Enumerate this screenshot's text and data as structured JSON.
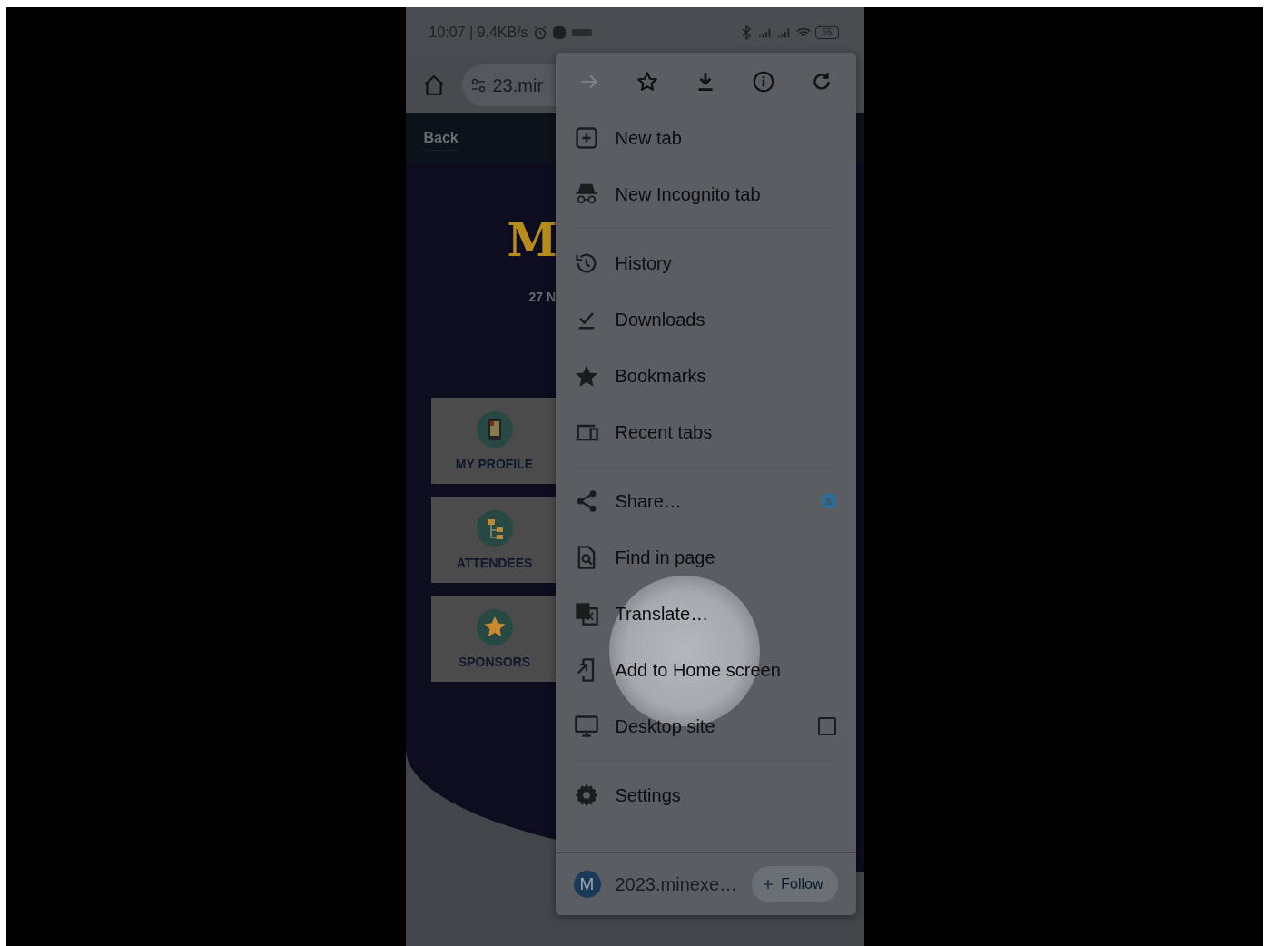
{
  "status_bar": {
    "text": "10:07 | 9.4KB/s",
    "battery": "55"
  },
  "toolbar": {
    "url": "23.mir"
  },
  "page": {
    "back_button": "Back",
    "logo_text": "M",
    "date": "27 N",
    "tiles": [
      {
        "label": "MY PROFILE",
        "kind": "profile"
      },
      {
        "label": "ATTENDEES",
        "kind": "attendees"
      },
      {
        "label": "SPONSORS",
        "kind": "sponsors"
      }
    ]
  },
  "menu": {
    "top_icons": [
      {
        "kind": "forward",
        "disabled": true
      },
      {
        "kind": "star",
        "disabled": false
      },
      {
        "kind": "download",
        "disabled": false
      },
      {
        "kind": "info",
        "disabled": false
      },
      {
        "kind": "refresh",
        "disabled": false
      }
    ],
    "groups": [
      [
        {
          "label": "New tab",
          "kind": "newtab"
        },
        {
          "label": "New Incognito tab",
          "kind": "incognito"
        }
      ],
      [
        {
          "label": "History",
          "kind": "history"
        },
        {
          "label": "Downloads",
          "kind": "downloads"
        },
        {
          "label": "Bookmarks",
          "kind": "bookmarks"
        },
        {
          "label": "Recent tabs",
          "kind": "recent"
        }
      ],
      [
        {
          "label": "Share…",
          "kind": "share",
          "badge": "S"
        },
        {
          "label": "Find in page",
          "kind": "find"
        },
        {
          "label": "Translate…",
          "kind": "translate"
        },
        {
          "label": "Add to Home screen",
          "kind": "addhome"
        },
        {
          "label": "Desktop site",
          "kind": "desktop",
          "checked": false
        }
      ],
      [
        {
          "label": "Settings",
          "kind": "settings"
        }
      ]
    ],
    "footer": {
      "avatar": "M",
      "site": "2023.minexe…",
      "follow_button": "Follow"
    }
  }
}
